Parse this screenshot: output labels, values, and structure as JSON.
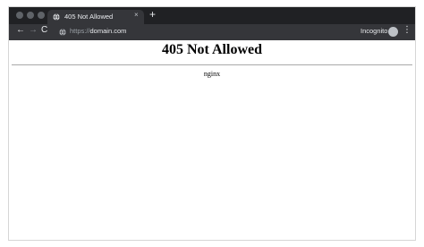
{
  "browser": {
    "tab": {
      "title": "405 Not Allowed",
      "close": "×"
    },
    "new_tab": "+",
    "nav": {
      "back": "←",
      "forward": "→",
      "reload": "C"
    },
    "address": {
      "scheme": "https://",
      "host": "domain.com"
    },
    "mode_label": "Incognito",
    "menu": "⋮"
  },
  "page": {
    "heading": "405 Not Allowed",
    "server": "nginx"
  },
  "colors": {
    "titlebar": "#202124",
    "toolbar": "#35363a",
    "text_light": "#e8eaed"
  }
}
